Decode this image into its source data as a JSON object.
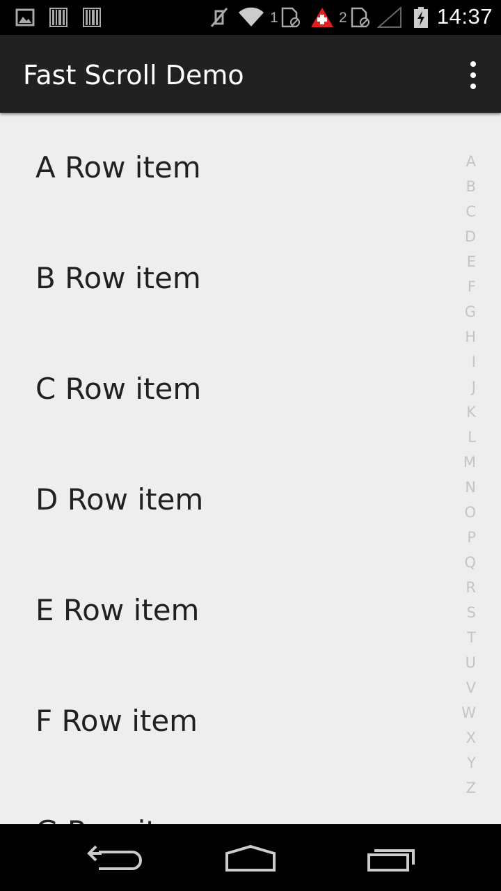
{
  "status_bar": {
    "time": "14:37",
    "sim1_label": "1",
    "sim2_label": "2",
    "icons": [
      "image-icon",
      "barcode-icon",
      "barcode-icon",
      "mute-icon",
      "wifi-icon",
      "sim-card-icon",
      "alert-icon",
      "sim-card-icon",
      "signal-icon",
      "battery-charging-icon"
    ],
    "colors": {
      "alert": "#e02020",
      "icon": "#aaaaaa"
    }
  },
  "app_bar": {
    "title": "Fast Scroll Demo",
    "menu_icon": "overflow-menu-icon"
  },
  "list": {
    "items": [
      "A Row item",
      "B Row item",
      "C Row item",
      "D Row item",
      "E Row item",
      "F Row item",
      "G Row item"
    ]
  },
  "index_bar": {
    "letters": [
      "A",
      "B",
      "C",
      "D",
      "E",
      "F",
      "G",
      "H",
      "I",
      "J",
      "K",
      "L",
      "M",
      "N",
      "O",
      "P",
      "Q",
      "R",
      "S",
      "T",
      "U",
      "V",
      "W",
      "X",
      "Y",
      "Z"
    ]
  },
  "nav_bar": {
    "buttons": [
      "back-icon",
      "home-icon",
      "recents-icon"
    ]
  }
}
